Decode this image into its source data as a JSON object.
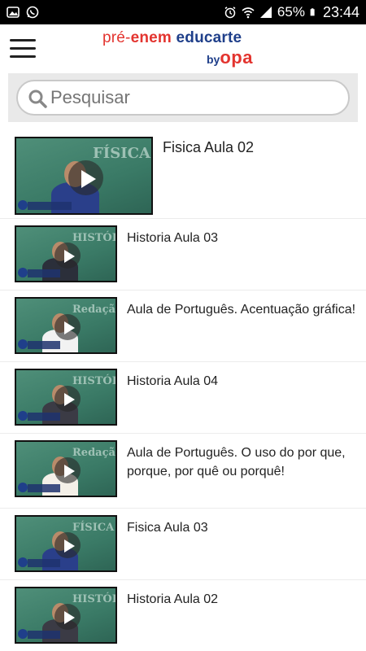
{
  "status_bar": {
    "battery": "65%",
    "time": "23:44"
  },
  "app": {
    "logo": {
      "pre": "pré-",
      "enem": "enem",
      "educarte": " educarte",
      "by": "by",
      "opa": "opa"
    }
  },
  "search": {
    "placeholder": "Pesquisar"
  },
  "videos": [
    {
      "title": "Fisica Aula 02",
      "board": "FÍSICA"
    },
    {
      "title": "Historia Aula 03",
      "board": "HISTÓRIA"
    },
    {
      "title": "Aula de Português. Acentuação gráfica!",
      "board": "Redação"
    },
    {
      "title": "Historia Aula 04",
      "board": "HISTÓRIA"
    },
    {
      "title": "Aula de Português. O uso do por que, porque,  por quê ou porquê!",
      "board": "Redação"
    },
    {
      "title": "Fisica Aula 03",
      "board": "FÍSICA"
    },
    {
      "title": "Historia Aula 02",
      "board": "HISTÓRIA"
    }
  ],
  "colors": {
    "brand_red": "#e3342f",
    "brand_blue": "#1f3f8a",
    "chalkboard": "#3a7a66"
  }
}
